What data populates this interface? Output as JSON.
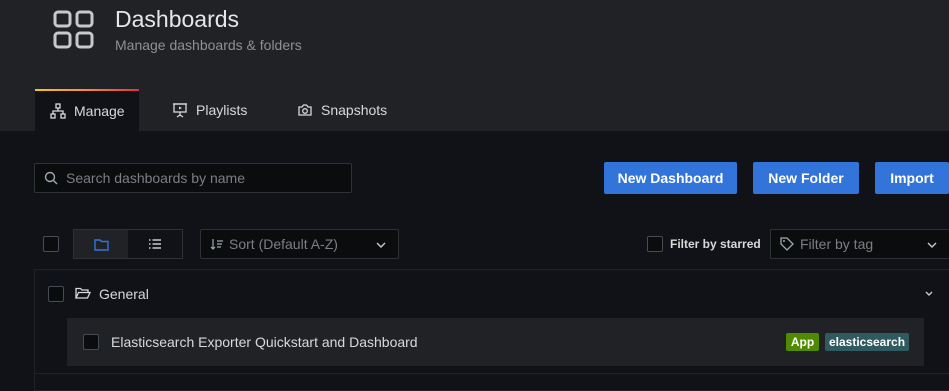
{
  "header": {
    "title": "Dashboards",
    "subtitle": "Manage dashboards & folders",
    "icon": "dashboards-grid-icon"
  },
  "tabs": [
    {
      "label": "Manage",
      "icon": "sitemap-icon",
      "active": true
    },
    {
      "label": "Playlists",
      "icon": "presentation-icon",
      "active": false
    },
    {
      "label": "Snapshots",
      "icon": "camera-icon",
      "active": false
    }
  ],
  "toolbar": {
    "search_placeholder": "Search dashboards by name",
    "new_dashboard_label": "New Dashboard",
    "new_folder_label": "New Folder",
    "import_label": "Import"
  },
  "filters": {
    "view_modes": [
      "folder-view",
      "list-view"
    ],
    "active_view": "folder-view",
    "sort_label": "Sort (Default A-Z)",
    "starred_label": "Filter by starred",
    "tag_placeholder": "Filter by tag"
  },
  "folders": [
    {
      "name": "General",
      "expanded": true,
      "dashboards": [
        {
          "title": "Elasticsearch Exporter Quickstart and Dashboard",
          "tags": [
            {
              "label": "App",
              "color": "#508a00"
            },
            {
              "label": "elasticsearch",
              "color": "#2f5a5f"
            }
          ]
        }
      ]
    }
  ],
  "colors": {
    "primary": "#3274d9",
    "background": "#111217",
    "panel": "#202226"
  }
}
